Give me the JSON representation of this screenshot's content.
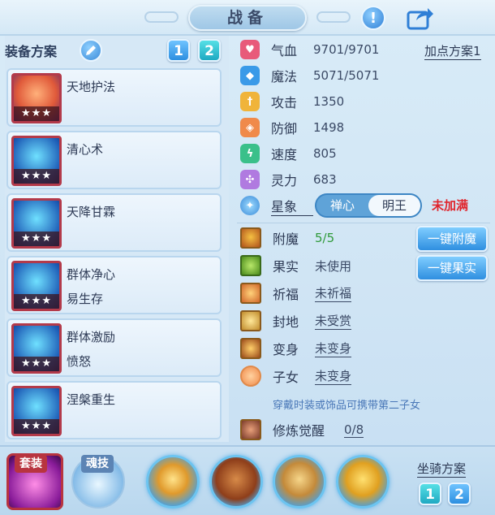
{
  "header": {
    "title": "战备"
  },
  "equipment": {
    "title": "装备方案",
    "plans": [
      "1",
      "2"
    ],
    "active_plan": "2"
  },
  "skills": [
    {
      "name": "天地护法",
      "sub": "",
      "stars": "★★★"
    },
    {
      "name": "清心术",
      "sub": "",
      "stars": "★★★"
    },
    {
      "name": "天降甘霖",
      "sub": "",
      "stars": "★★★"
    },
    {
      "name": "群体净心",
      "sub": "易生存",
      "stars": "★★★"
    },
    {
      "name": "群体激励",
      "sub": "愤怒",
      "stars": "★★★"
    },
    {
      "name": "涅槃重生",
      "sub": "",
      "stars": "★★★"
    }
  ],
  "attributes": {
    "plan_link": "加点方案1",
    "stats": [
      {
        "label": "气血",
        "value": "9701/9701",
        "icon": "heart-icon",
        "color": "#e85a7a"
      },
      {
        "label": "魔法",
        "value": "5071/5071",
        "icon": "diamond-icon",
        "color": "#3a9ae8"
      },
      {
        "label": "攻击",
        "value": "1350",
        "icon": "sword-icon",
        "color": "#f0b43a"
      },
      {
        "label": "防御",
        "value": "1498",
        "icon": "shield-icon",
        "color": "#f08a4a"
      },
      {
        "label": "速度",
        "value": "805",
        "icon": "lightning-icon",
        "color": "#3ac08a"
      },
      {
        "label": "灵力",
        "value": "683",
        "icon": "spirit-icon",
        "color": "#b07ae0"
      }
    ],
    "xingxiang": {
      "label": "星象",
      "options": [
        "禅心",
        "明王"
      ],
      "selected": "明王",
      "status": "未加满"
    }
  },
  "enhance": {
    "rows": [
      {
        "label": "附魔",
        "value": "5/5"
      },
      {
        "label": "果实",
        "value": "未使用"
      },
      {
        "label": "祈福",
        "value": "未祈福"
      },
      {
        "label": "封地",
        "value": "未受赏"
      },
      {
        "label": "变身",
        "value": "未变身"
      },
      {
        "label": "子女",
        "value": "未变身"
      }
    ],
    "btn_enchant": "一键附魔",
    "btn_fruit": "一键果实",
    "hint": "穿戴时装或饰品可携带第二子女",
    "awaken_label": "修炼觉醒",
    "awaken_value": "0/8"
  },
  "bottom": {
    "tab_suit": "套装",
    "tab_soul": "魂技",
    "mount_title": "坐骑方案",
    "mount_plans": [
      "1",
      "2"
    ],
    "active_mount_plan": "1"
  },
  "colors": {
    "accent": "#2d8fe0",
    "warn": "#e0242c",
    "ok": "#2f9a3a"
  }
}
